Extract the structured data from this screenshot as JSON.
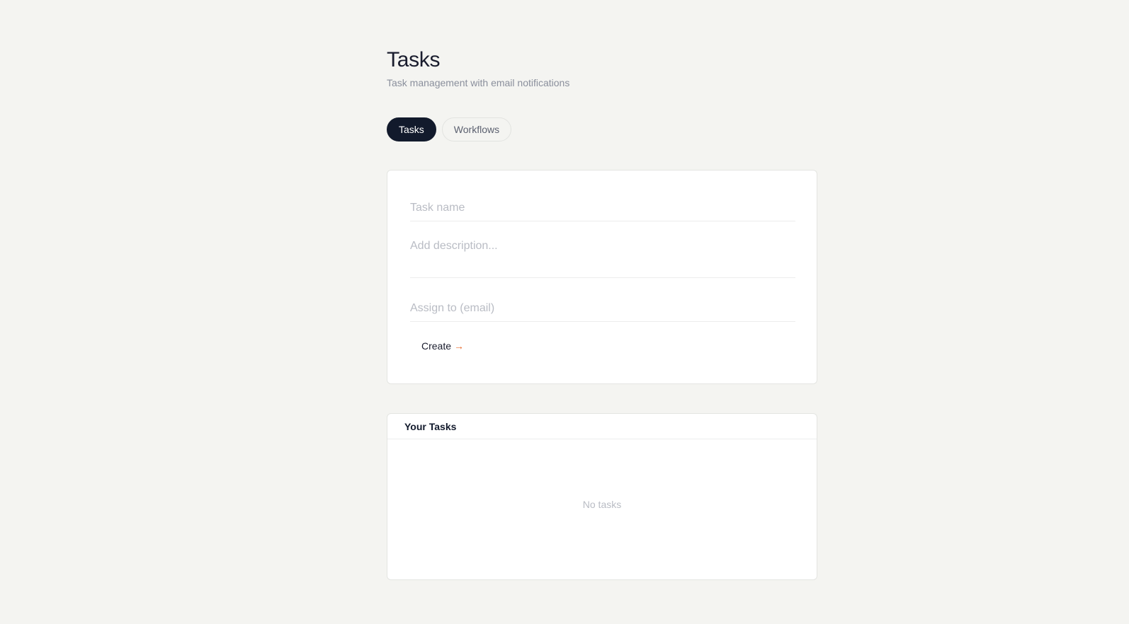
{
  "header": {
    "title": "Tasks",
    "subtitle": "Task management with email notifications"
  },
  "tabs": [
    {
      "label": "Tasks",
      "active": true
    },
    {
      "label": "Workflows",
      "active": false
    }
  ],
  "form": {
    "task_name_placeholder": "Task name",
    "task_name_value": "",
    "description_placeholder": "Add description...",
    "description_value": "",
    "assign_placeholder": "Assign to (email)",
    "assign_value": "",
    "create_label": "Create",
    "create_arrow": "→",
    "arrow_icon": "arrow-right-icon"
  },
  "task_list": {
    "title": "Your Tasks",
    "empty_text": "No tasks",
    "items": []
  },
  "colors": {
    "background": "#f4f4f1",
    "active_tab": "#121a2c",
    "accent_arrow": "#e8692a"
  }
}
